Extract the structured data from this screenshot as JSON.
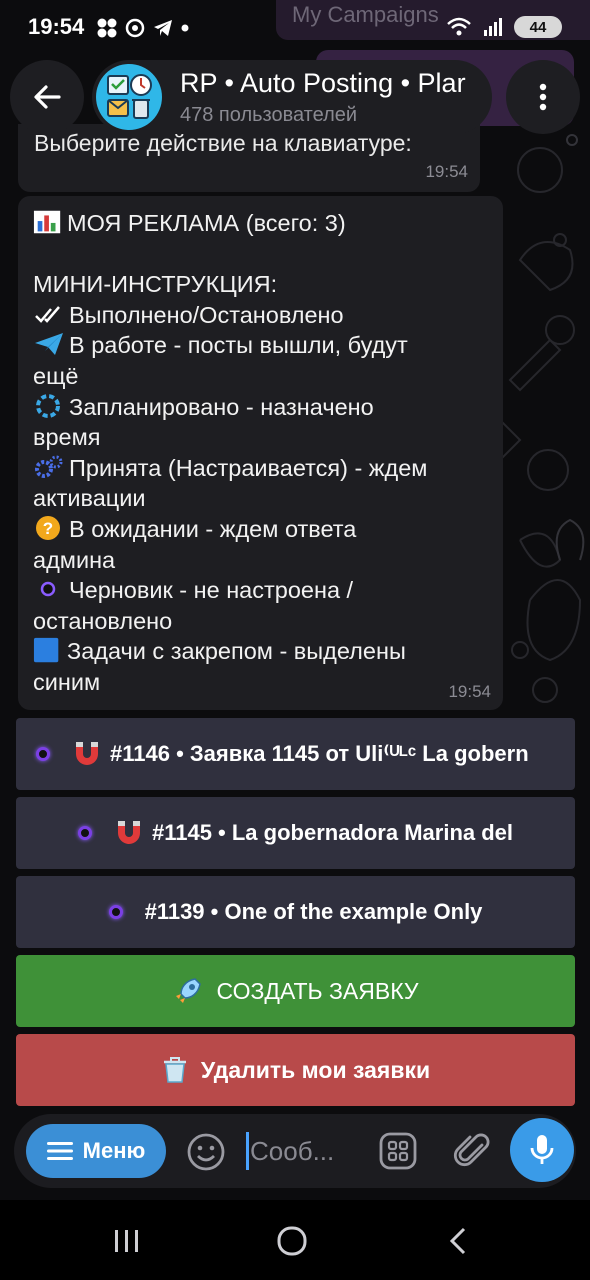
{
  "status_bar": {
    "time": "19:54",
    "battery": "44"
  },
  "background_overlay": {
    "title": "My Campaigns"
  },
  "header": {
    "title": "RP • Auto Posting • Plar",
    "subtitle": "478 пользователей"
  },
  "messages": [
    {
      "text": "Выберите действие на клавиатуре:",
      "time": "19:54"
    },
    {
      "heading": "МОЯ РЕКЛАМА (всего: 3)",
      "instructions_title": "МИНИ-ИНСТРУКЦИЯ:",
      "lines": [
        "Выполнено/Остановлено",
        "В работе - посты вышли, будут",
        "ещё",
        "Запланировано - назначено",
        "время",
        "Принята (Настраивается) - ждем",
        "активации",
        "В ожидании - ждем ответа",
        "админа",
        "Черновик - не настроена /",
        "остановлено",
        "Задачи с закрепом - выделены",
        "синим"
      ],
      "time": "19:54"
    }
  ],
  "inline_keyboard": [
    {
      "label": "#1146 • Заявка 1145 от Uli⁽ᵁᴸᶜ La gobern"
    },
    {
      "label": "#1145 • La gobernadora Marina del"
    },
    {
      "label": "#1139 • One of the example Only"
    },
    {
      "label": "СОЗДАТЬ ЗАЯВКУ"
    },
    {
      "label": "Удалить мои заявки"
    }
  ],
  "input_bar": {
    "menu_label": "Меню",
    "placeholder": "Сооб..."
  },
  "colors": {
    "accent_blue": "#3b8fd6",
    "create_button": "#3f9138",
    "delete_button": "#b84a4a",
    "bubble": "#1e1e22",
    "keyboard_button": "#30303e"
  }
}
